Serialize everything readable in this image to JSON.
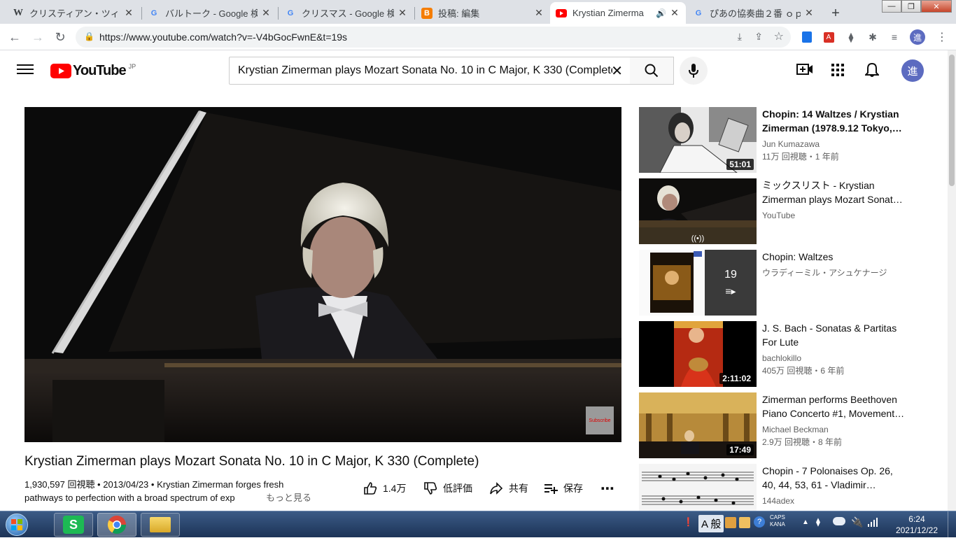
{
  "browser": {
    "tabs": [
      {
        "label": "クリスティアン・ツィマ",
        "favicon": "W"
      },
      {
        "label": "バルトーク - Google 検",
        "favicon": "G"
      },
      {
        "label": "クリスマス - Google 検",
        "favicon": "G"
      },
      {
        "label": "投稿: 編集",
        "favicon": "B"
      },
      {
        "label": "Krystian Zimerma",
        "favicon": "youtube"
      },
      {
        "label": "ぴあの協奏曲２番 ｏｐ",
        "favicon": "G"
      }
    ],
    "url": "https://www.youtube.com/watch?v=-V4bGocFwnE&t=19s",
    "new_tab": "+"
  },
  "youtube": {
    "logo_text": "YouTube",
    "region": "JP",
    "search_query": "Krystian Zimerman plays Mozart Sonata No. 10 in C Major, K 330 (Complete",
    "avatar_letter": "進",
    "accent": "#ff0000"
  },
  "video": {
    "title": "Krystian Zimerman plays Mozart Sonata No. 10 in C Major, K 330 (Complete)",
    "views_date": "1,930,597 回視聴 • 2013/04/23 • ",
    "desc_first": "Krystian Zimerman forges fresh",
    "desc_second": "pathways to perfection with a broad spectrum of exp",
    "show_more": "もっと見る",
    "likes": "1.4万",
    "dislike_label": "低評価",
    "share_label": "共有",
    "save_label": "保存",
    "watermark": "Subscribe"
  },
  "recommendations": [
    {
      "title": "Chopin: 14 Waltzes / Krystian Zimerman (1978.9.12 Tokyo,…",
      "channel": "Jun Kumazawa",
      "meta": "11万 回視聴・1 年前",
      "duration": "51:01"
    },
    {
      "title": "ミックスリスト - Krystian Zimerman plays Mozart Sonat…",
      "channel": "YouTube",
      "meta": "",
      "duration": "((•))"
    },
    {
      "title": "Chopin: Waltzes",
      "channel": "ウラディーミル・アシュケナージ",
      "meta": "",
      "duration": "19"
    },
    {
      "title": "J. S. Bach - Sonatas & Partitas For Lute",
      "channel": "bachlokillo",
      "meta": "405万 回視聴・6 年前",
      "duration": "2:11:02"
    },
    {
      "title": "Zimerman performs Beethoven Piano Concerto #1, Movement…",
      "channel": "Michael Beckman",
      "meta": "2.9万 回視聴・8 年前",
      "duration": "17:49"
    },
    {
      "title": "Chopin - 7 Polonaises Op. 26, 40, 44, 53, 61 - Vladimir…",
      "channel": "144adex",
      "meta": "",
      "duration": ""
    }
  ],
  "taskbar": {
    "ime_label": "A 般",
    "caps": "CAPS",
    "kana": "KANA",
    "time": "6:24",
    "date": "2021/12/22"
  }
}
